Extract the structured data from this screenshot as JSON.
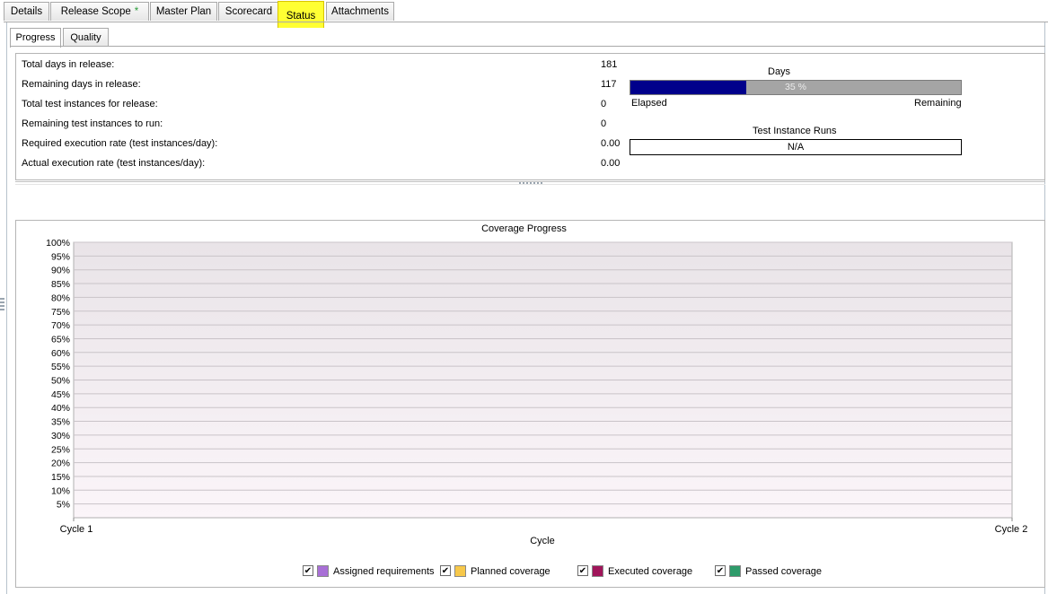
{
  "top_tabs": [
    {
      "label": "Details"
    },
    {
      "label": "Release Scope",
      "badge": "*"
    },
    {
      "label": "Master Plan"
    },
    {
      "label": "Scorecard"
    },
    {
      "label": "Status",
      "active": true
    },
    {
      "label": "Attachments"
    }
  ],
  "sub_tabs": [
    {
      "label": "Progress",
      "active": true
    },
    {
      "label": "Quality"
    }
  ],
  "progress": {
    "rows": [
      {
        "label": "Total days in release:",
        "value": "181"
      },
      {
        "label": "Remaining days in release:",
        "value": "117"
      },
      {
        "label": "Total test instances for release:",
        "value": "0"
      },
      {
        "label": "Remaining test instances to run:",
        "value": "0"
      },
      {
        "label": "Required execution rate (test instances/day):",
        "value": "0.00"
      },
      {
        "label": "Actual execution rate (test instances/day):",
        "value": "0.00"
      }
    ],
    "days": {
      "title": "Days",
      "percent_label": "35 %",
      "elapsed_fraction": 0.35,
      "elapsed_label": "Elapsed",
      "remaining_label": "Remaining"
    },
    "runs": {
      "title": "Test Instance Runs",
      "value": "N/A"
    }
  },
  "chart_data": {
    "type": "line",
    "title": "Coverage Progress",
    "xlabel": "Cycle",
    "ylabel": "",
    "categories": [
      "Cycle 1",
      "Cycle 2"
    ],
    "y_ticks": [
      "5%",
      "10%",
      "15%",
      "20%",
      "25%",
      "30%",
      "35%",
      "40%",
      "45%",
      "50%",
      "55%",
      "60%",
      "65%",
      "70%",
      "75%",
      "80%",
      "85%",
      "90%",
      "95%",
      "100%"
    ],
    "ylim": [
      0,
      100
    ],
    "grid": true,
    "series": [
      {
        "name": "Assigned requirements",
        "color": "#a86fd6",
        "checked": true,
        "values": []
      },
      {
        "name": "Planned coverage",
        "color": "#f7c84a",
        "checked": true,
        "values": []
      },
      {
        "name": "Executed coverage",
        "color": "#a0155a",
        "checked": true,
        "values": []
      },
      {
        "name": "Passed coverage",
        "color": "#2e9b6a",
        "checked": true,
        "values": []
      }
    ],
    "legend_position": "bottom"
  },
  "icons": {
    "checkbox_mark": "✔"
  }
}
